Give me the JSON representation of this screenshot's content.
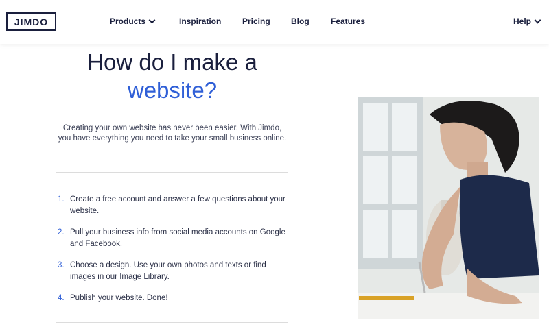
{
  "header": {
    "logo": "JIMDO",
    "nav": [
      {
        "label": "Products",
        "has_dropdown": true
      },
      {
        "label": "Inspiration"
      },
      {
        "label": "Pricing"
      },
      {
        "label": "Blog"
      },
      {
        "label": "Features"
      }
    ],
    "help": {
      "label": "Help",
      "has_dropdown": true
    }
  },
  "hero": {
    "title_line1": "How do I make a",
    "title_line2": "website?",
    "intro": "Creating your own website has never been easier. With Jimdo, you have everything you need to take your small business online."
  },
  "steps": [
    {
      "num": "1.",
      "text": "Create a free account and answer a few questions about your website."
    },
    {
      "num": "2.",
      "text": "Pull your business info from social media accounts on Google and Facebook."
    },
    {
      "num": "3.",
      "text": "Choose a design. Use your own photos and texts or find images in our Image Library."
    },
    {
      "num": "4.",
      "text": "Publish your website. Done!"
    }
  ],
  "colors": {
    "brand_dark": "#1a1f3d",
    "accent_blue": "#2f5fd7"
  },
  "icons": {
    "dropdown": "chevron-down-icon"
  }
}
